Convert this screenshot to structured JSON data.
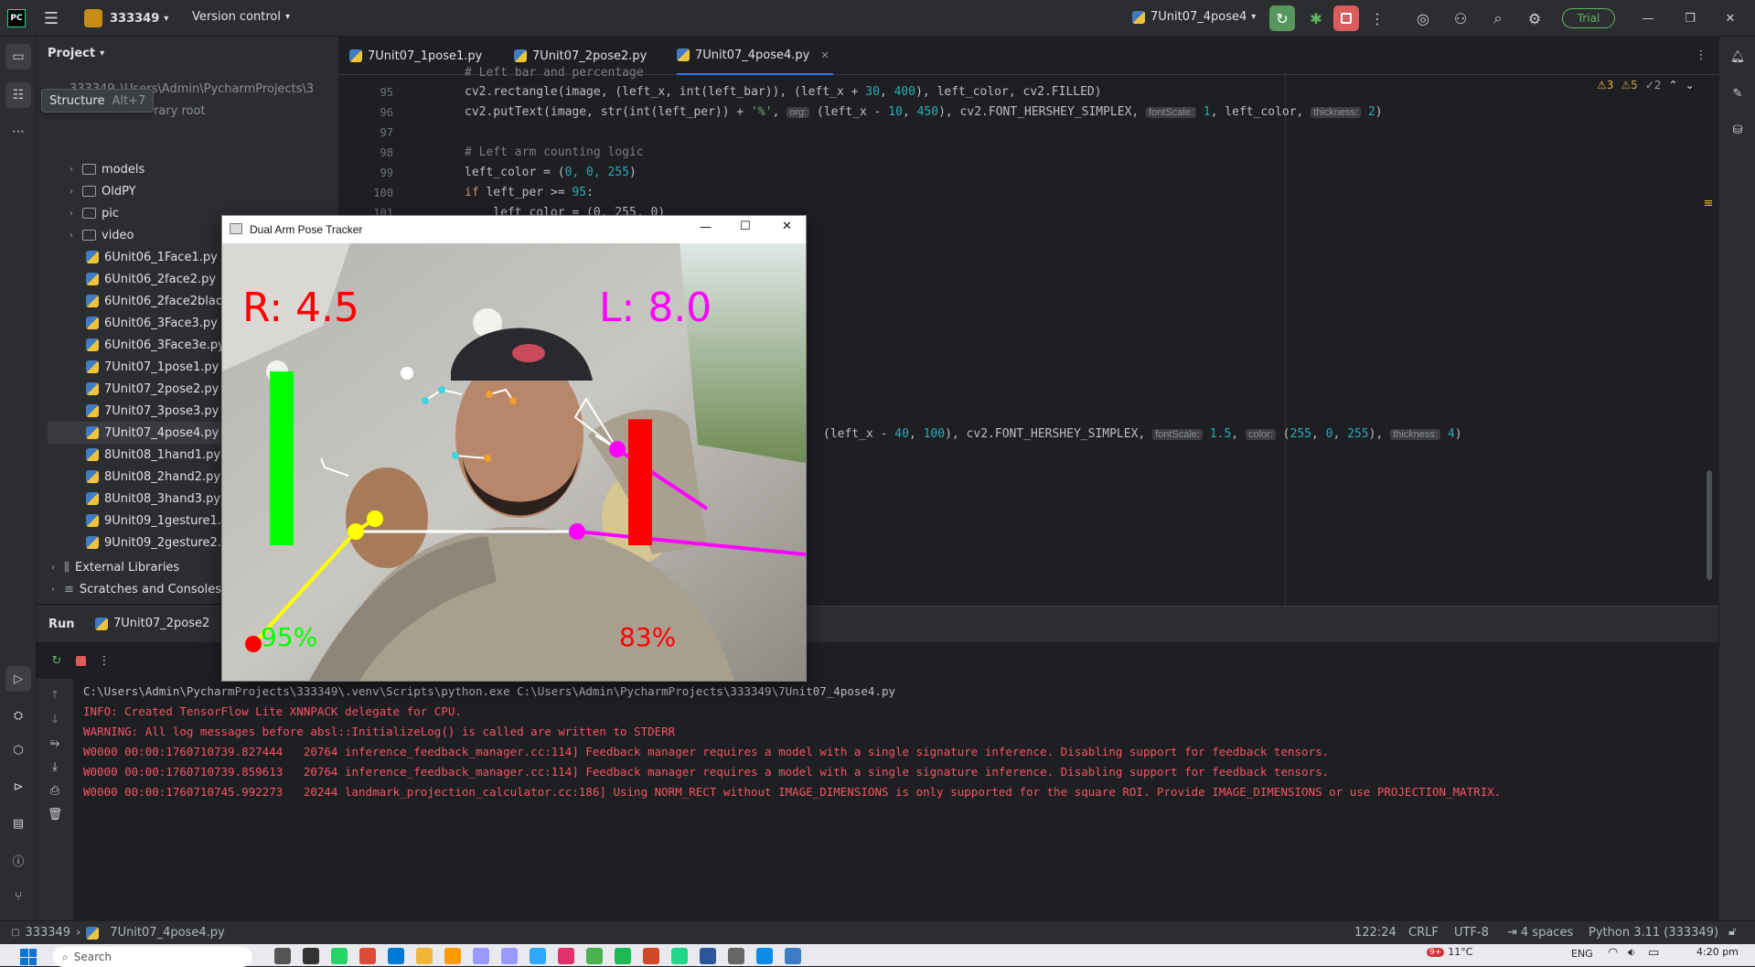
{
  "titlebar": {
    "project_name": "333349",
    "version_control": "Version control",
    "run_config": "7Unit07_4pose4",
    "trial": "Trial"
  },
  "tooltip": {
    "label": "Structure",
    "shortcut": "Alt+7"
  },
  "project_panel": {
    "title": "Project",
    "root_path": "\\Users\\Admin\\PycharmProjects\\3",
    "root_name": "333349",
    "root_suffix": "rary root",
    "folders": [
      "models",
      "OldPY",
      "pic",
      "video"
    ],
    "files": [
      "6Unit06_1Face1.py",
      "6Unit06_2face2.py",
      "6Unit06_2face2black",
      "6Unit06_3Face3.py",
      "6Unit06_3Face3e.py",
      "7Unit07_1pose1.py",
      "7Unit07_2pose2.py",
      "7Unit07_3pose3.py",
      "7Unit07_4pose4.py",
      "8Unit08_1hand1.py",
      "8Unit08_2hand2.py",
      "8Unit08_3hand3.py",
      "9Unit09_1gesture1.p",
      "9Unit09_2gesture2.p"
    ],
    "selected": "7Unit07_4pose4.py",
    "external": "External Libraries",
    "scratches": "Scratches and Consoles"
  },
  "tabs": [
    "7Unit07_1pose1.py",
    "7Unit07_2pose2.py",
    "7Unit07_4pose4.py"
  ],
  "active_tab": "7Unit07_4pose4.py",
  "inspections": {
    "warn1": "3",
    "warn2": "5",
    "weak": "2"
  },
  "editor": {
    "line_numbers": [
      "95",
      "96",
      "97",
      "98",
      "99",
      "100",
      "101"
    ],
    "l94": "# Left bar and percentage",
    "l95_a": "cv2.rectangle(image, (left_x, int(left_bar)), (left_x + ",
    "l95_n1": "30",
    "l95_b": ", ",
    "l95_n2": "400",
    "l95_c": "), left_color, cv2.FILLED)",
    "l96_a": "cv2.putText(image, str(int(left_per)) + ",
    "l96_s": "'%'",
    "l96_b": ", ",
    "l96_h1": "org:",
    "l96_c": " (left_x - ",
    "l96_n1": "10",
    "l96_d": ", ",
    "l96_n2": "450",
    "l96_e": "), cv2.FONT_HERSHEY_SIMPLEX, ",
    "l96_h2": "fontScale:",
    "l96_n3": " 1",
    "l96_f": ", left_color, ",
    "l96_h3": "thickness:",
    "l96_n4": " 2",
    "l96_g": ")",
    "l98": "# Left arm counting logic",
    "l99_a": "left_color = (",
    "l99_n": "0, 0, 255",
    "l99_b": ")",
    "l100_kw": "if",
    "l100_a": " left_per >= ",
    "l100_n": "95",
    "l100_b": ":",
    "l101": "    left_color = (0, 255, 0)",
    "lx_a": "(left_x - ",
    "lx_n1": "40",
    "lx_b": ", ",
    "lx_n2": "100",
    "lx_c": "), cv2.FONT_HERSHEY_SIMPLEX, ",
    "lx_h1": "fontScale:",
    "lx_n3": " 1.5",
    "lx_d": ", ",
    "lx_h2": "color:",
    "lx_e": " (",
    "lx_n4": "255",
    "lx_f": ", ",
    "lx_n5": "0",
    "lx_g": ", ",
    "lx_n6": "255",
    "lx_h": "), ",
    "lx_h3": "thickness:",
    "lx_n7": " 4",
    "lx_i": ")"
  },
  "popup": {
    "title": "Dual Arm Pose Tracker",
    "right_counter": "R: 4.5",
    "left_counter": "L: 8.0",
    "right_percent": "95%",
    "left_percent": "83%",
    "right_level_pct": 95,
    "left_level_pct": 83
  },
  "run": {
    "title": "Run",
    "config": "7Unit07_2pose2",
    "lines": [
      {
        "text": "C:\\Users\\Admin\\PycharmProjects\\333349\\.venv\\Scripts\\python.exe C:\\Users\\Admin\\PycharmProjects\\333349\\7Unit07_4pose4.py",
        "color": "#bcbec4"
      },
      {
        "text": "INFO: Created TensorFlow Lite XNNPACK delegate for CPU.",
        "color": "#f75464"
      },
      {
        "text": "WARNING: All log messages before absl::InitializeLog() is called are written to STDERR",
        "color": "#f75464"
      },
      {
        "text": "W0000 00:00:1760710739.827444   20764 inference_feedback_manager.cc:114] Feedback manager requires a model with a single signature inference. Disabling support for feedback tensors.",
        "color": "#f75464"
      },
      {
        "text": "W0000 00:00:1760710739.859613   20764 inference_feedback_manager.cc:114] Feedback manager requires a model with a single signature inference. Disabling support for feedback tensors.",
        "color": "#f75464"
      },
      {
        "text": "W0000 00:00:1760710745.992273   20244 landmark_projection_calculator.cc:186] Using NORM_RECT without IMAGE_DIMENSIONS is only supported for the square ROI. Provide IMAGE_DIMENSIONS or use PROJECTION_MATRIX.",
        "color": "#f75464"
      }
    ]
  },
  "status": {
    "project": "333349",
    "file": "7Unit07_4pose4.py",
    "position": "122:24",
    "line_sep": "CRLF",
    "encoding": "UTF-8",
    "indent": "4 spaces",
    "interpreter": "Python 3.11 (333349)"
  },
  "taskbar": {
    "search": "Search",
    "temp": "11°C",
    "lang": "ENG",
    "time": "4:20 pm",
    "badge": "2",
    "weather_badge": "9+"
  },
  "colors": {
    "accent": "#3574f0",
    "run_green": "#57965c",
    "stop_red": "#db5c5c"
  }
}
